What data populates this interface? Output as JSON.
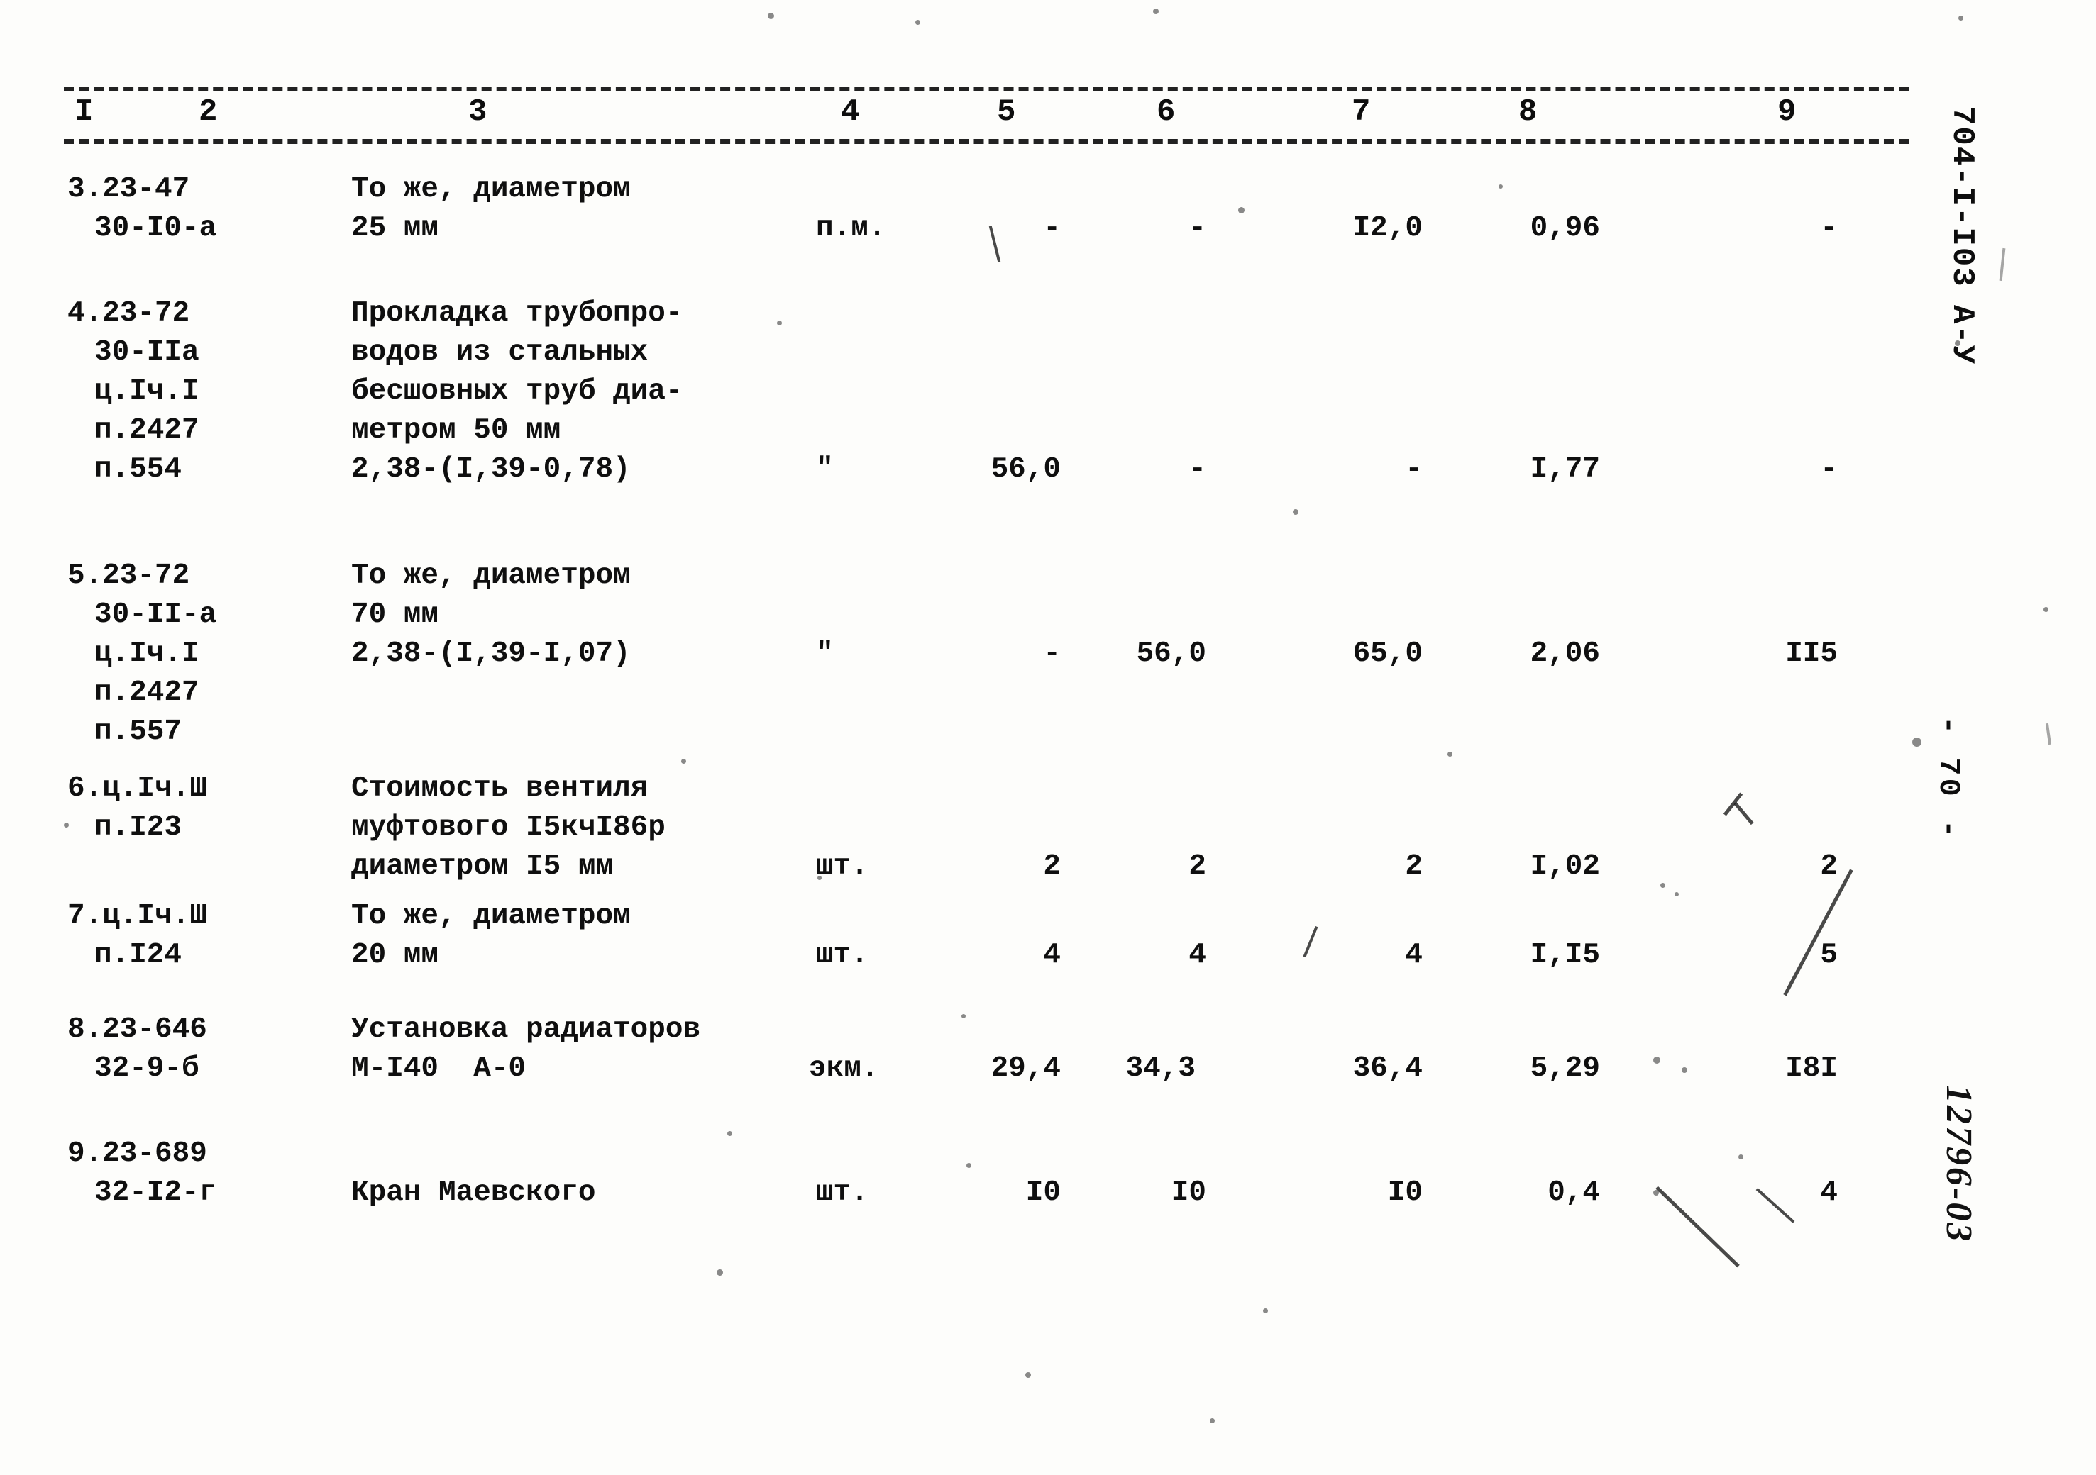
{
  "document": {
    "doc_code": "704-I-I03",
    "series_mark": "А-У",
    "page_number": "- 70 -",
    "handwritten_number": "12796-03"
  },
  "table": {
    "column_headers": [
      "I",
      "2",
      "3",
      "4",
      "5",
      "6",
      "7",
      "8",
      "9"
    ],
    "rows": [
      {
        "no": "3.23-47",
        "code_lines": [
          "3.23-47",
          "30-I0-a"
        ],
        "description_lines": [
          "То же, диаметром",
          "25 мм"
        ],
        "unit": "п.м.",
        "c5": "-",
        "c6": "-",
        "c7": "I2,0",
        "c8": "0,96",
        "c9": "-"
      },
      {
        "no": "4.23-72",
        "code_lines": [
          "4.23-72",
          "30-IIа",
          "ц.Iч.I",
          "п.2427",
          "п.554"
        ],
        "description_lines": [
          "Прокладка трубопро-",
          "водов из стальных",
          "бесшовных труб диа-",
          "метром 50 мм",
          "2,38-(I,39-0,78)"
        ],
        "unit": "\"",
        "c5": "56,0",
        "c6": "-",
        "c7": "-",
        "c8": "I,77",
        "c9": "-"
      },
      {
        "no": "5.23-72",
        "code_lines": [
          "5.23-72",
          "30-II-а",
          "ц.Iч.I",
          "п.2427",
          "п.557"
        ],
        "description_lines": [
          "То же, диаметром",
          "70 мм",
          "2,38-(I,39-I,07)"
        ],
        "unit": "\"",
        "c5": "-",
        "c6": "56,0",
        "c7": "65,0",
        "c8": "2,06",
        "c9": "II5"
      },
      {
        "no": "6.ц.Iч.Ш",
        "code_lines": [
          "6.ц.Iч.Ш",
          "п.I23"
        ],
        "description_lines": [
          "Стоимость вентиля",
          "муфтового I5кчI86р",
          "диаметром I5 мм"
        ],
        "unit": "шт.",
        "c5": "2",
        "c6": "2",
        "c7": "2",
        "c8": "I,02",
        "c9": "2"
      },
      {
        "no": "7.ц.Iч.Ш",
        "code_lines": [
          "7.ц.Iч.Ш",
          "п.I24"
        ],
        "description_lines": [
          "То же, диаметром",
          "20 мм"
        ],
        "unit": "шт.",
        "c5": "4",
        "c6": "4",
        "c7": "4",
        "c8": "I,I5",
        "c9": "5"
      },
      {
        "no": "8.23-646",
        "code_lines": [
          "8.23-646",
          "32-9-б"
        ],
        "description_lines": [
          "Установка радиаторов",
          "М-I40  А-0"
        ],
        "unit": "экм.",
        "c5": "29,4",
        "c6": "34,3",
        "c7": "36,4",
        "c8": "5,29",
        "c9": "I8I"
      },
      {
        "no": "9.23-689",
        "code_lines": [
          "9.23-689",
          "32-I2-г"
        ],
        "description_lines": [
          "Кран Маевского"
        ],
        "unit": "шт.",
        "c5": "I0",
        "c6": "I0",
        "c7": "I0",
        "c8": "0,4",
        "c9": "4"
      }
    ]
  }
}
